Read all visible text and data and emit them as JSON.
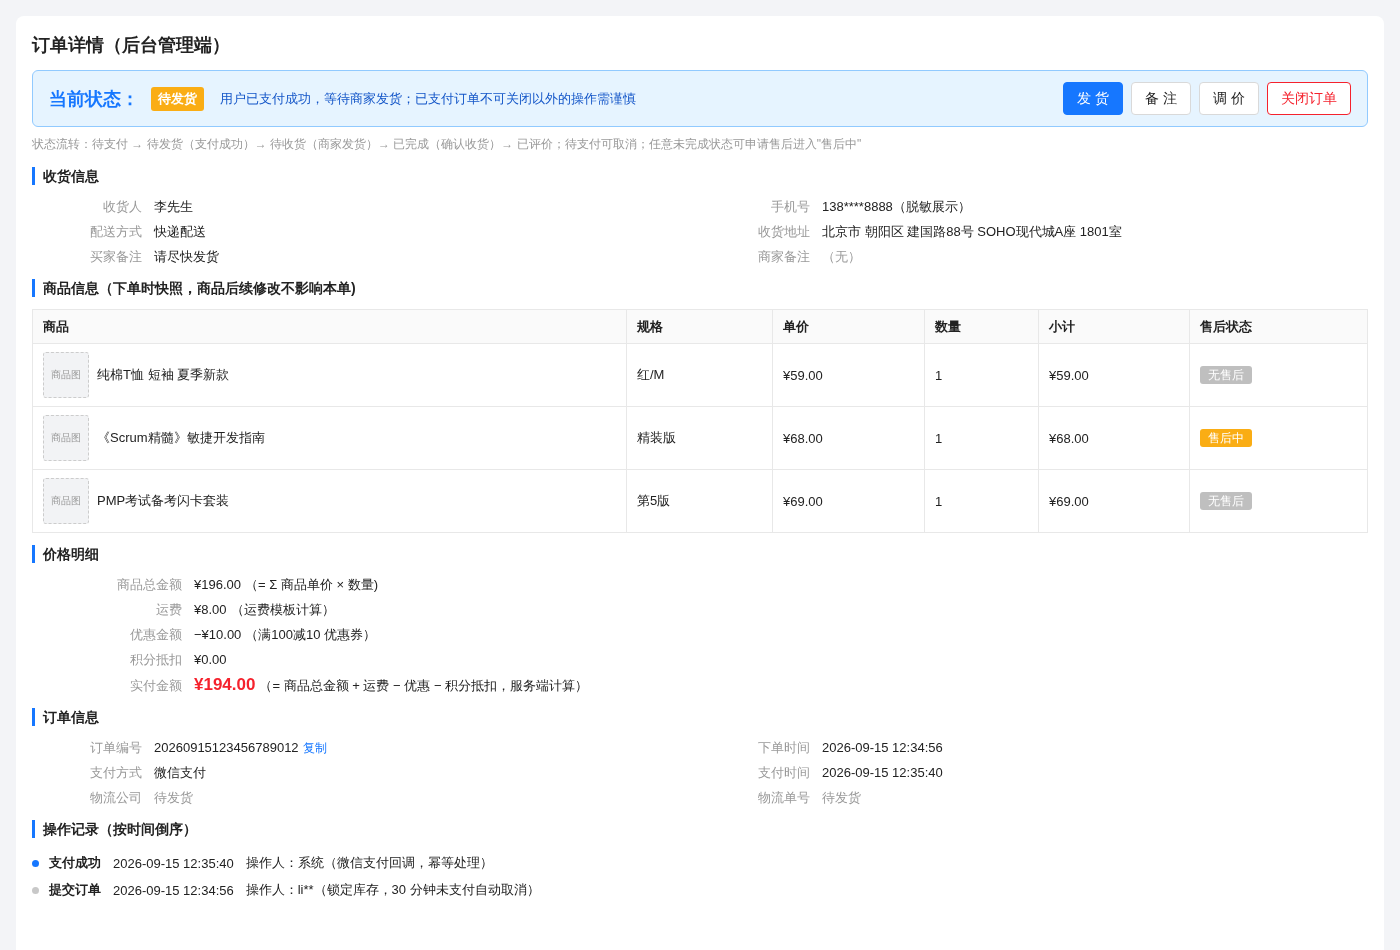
{
  "title": "订单详情（后台管理端）",
  "status_banner": {
    "label": "当前状态：",
    "badge": "待发货",
    "message": "用户已支付成功，等待商家发货；已支付订单不可关闭以外的操作需谨慎",
    "buttons": [
      {
        "label": "发 货",
        "kind": "primary"
      },
      {
        "label": "备 注",
        "kind": "default"
      },
      {
        "label": "调 价",
        "kind": "default"
      },
      {
        "label": "关闭订单",
        "kind": "danger"
      }
    ]
  },
  "flow_note": "状态流转：待支付 → 待发货（支付成功）→ 待收货（商家发货）→ 已完成（确认收货）→ 已评价；待支付可取消；任意未完成状态可申请售后进入\"售后中\"",
  "shipping": {
    "heading": "收货信息",
    "items": [
      {
        "label": "收货人",
        "value": "李先生",
        "muted": false
      },
      {
        "label": "手机号",
        "value": "138****8888（脱敏展示）",
        "muted": false
      },
      {
        "label": "配送方式",
        "value": "快递配送",
        "muted": false
      },
      {
        "label": "收货地址",
        "value": "北京市 朝阳区 建国路88号 SOHO现代城A座 1801室",
        "muted": false
      },
      {
        "label": "买家备注",
        "value": "请尽快发货",
        "muted": false
      },
      {
        "label": "商家备注",
        "value": "（无）",
        "muted": true
      }
    ]
  },
  "products": {
    "heading": "商品信息（下单时快照，商品后续修改不影响本单)",
    "columns": [
      "商品",
      "规格",
      "单价",
      "数量",
      "小计",
      "售后状态"
    ],
    "rows": [
      {
        "thumb": "商品图",
        "name": "纯棉T恤 短袖 夏季新款",
        "spec": "红/M",
        "price": "¥59.00",
        "qty": "1",
        "subtotal": "¥59.00",
        "after_sale": {
          "label": "无售后",
          "kind": "none"
        }
      },
      {
        "thumb": "商品图",
        "name": "《Scrum精髓》敏捷开发指南",
        "spec": "精装版",
        "price": "¥68.00",
        "qty": "1",
        "subtotal": "¥68.00",
        "after_sale": {
          "label": "售后中",
          "kind": "active"
        }
      },
      {
        "thumb": "商品图",
        "name": "PMP考试备考闪卡套装",
        "spec": "第5版",
        "price": "¥69.00",
        "qty": "1",
        "subtotal": "¥69.00",
        "after_sale": {
          "label": "无售后",
          "kind": "none"
        }
      }
    ]
  },
  "pricing": {
    "heading": "价格明细",
    "rows": [
      {
        "label": "商品总金额",
        "amount": "¥196.00",
        "note": "（= Σ 商品单价 × 数量)",
        "kind": "line"
      },
      {
        "label": "运费",
        "amount": "¥8.00",
        "note": "（运费模板计算）",
        "kind": "line"
      },
      {
        "label": "优惠金额",
        "amount": "−¥10.00",
        "note": "（满100减10 优惠券）",
        "kind": "line"
      },
      {
        "label": "积分抵扣",
        "amount": "¥0.00",
        "kind": "line"
      },
      {
        "label": "实付金额",
        "amount": "¥194.00",
        "note": "（= 商品总金额 + 运费 − 优惠 − 积分抵扣，服务端计算）",
        "kind": "total"
      }
    ]
  },
  "order_info": {
    "heading": "订单信息",
    "items": [
      {
        "label": "订单编号",
        "value": "20260915123456789012",
        "action": "复制",
        "muted": false
      },
      {
        "label": "下单时间",
        "value": "2026-09-15 12:34:56",
        "muted": false
      },
      {
        "label": "支付方式",
        "value": "微信支付",
        "muted": false
      },
      {
        "label": "支付时间",
        "value": "2026-09-15 12:35:40",
        "muted": false
      },
      {
        "label": "物流公司",
        "value": "待发货",
        "muted": true
      },
      {
        "label": "物流单号",
        "value": "待发货",
        "muted": true
      }
    ]
  },
  "log": {
    "heading": "操作记录（按时间倒序）",
    "entries": [
      {
        "action": "支付成功",
        "time": "2026-09-15 12:35:40",
        "detail": "操作人：系统（微信支付回调，幂等处理）",
        "color": "#1677ff"
      },
      {
        "action": "提交订单",
        "time": "2026-09-15 12:34:56",
        "detail": "操作人：li**（锁定库存，30 分钟未支付自动取消）",
        "color": "#c8c8c8"
      }
    ]
  }
}
